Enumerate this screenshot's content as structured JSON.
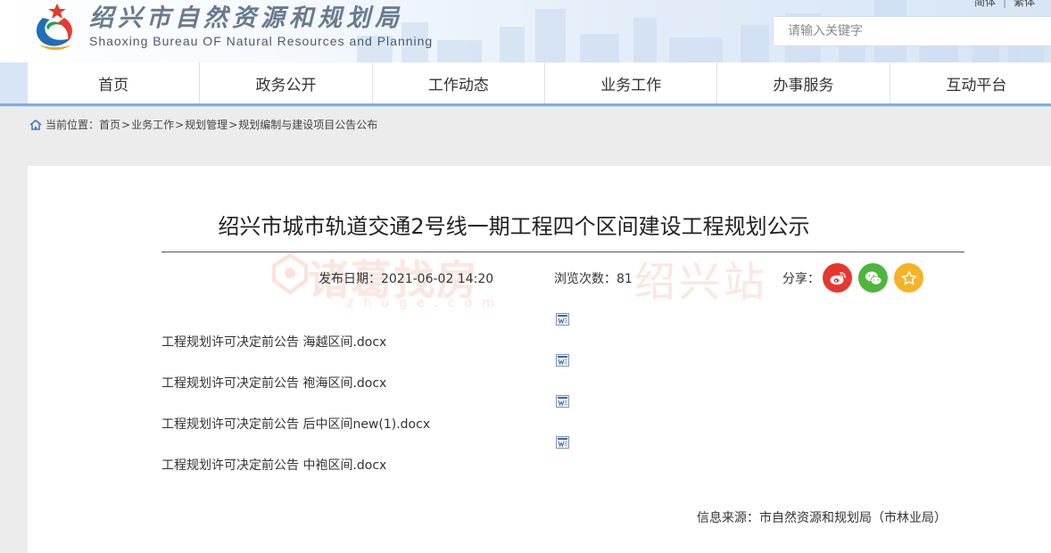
{
  "header": {
    "title": "绍兴市自然资源和规划局",
    "subtitle": "Shaoxing Bureau OF Natural Resources and Planning",
    "lang_simplified": "简体",
    "lang_separator": "|",
    "lang_traditional": "繁体",
    "search_placeholder": "请输入关键字"
  },
  "nav": {
    "items": [
      "首页",
      "政务公开",
      "工作动态",
      "业务工作",
      "办事服务",
      "互动平台"
    ]
  },
  "breadcrumb": {
    "label": "当前位置：",
    "items": [
      "首页",
      "业务工作",
      "规划管理",
      "规划编制与建设项目公告公布"
    ],
    "separator": ">"
  },
  "article": {
    "title": "绍兴市城市轨道交通2号线一期工程四个区间建设工程规划公示",
    "date_label": "发布日期：",
    "date": "2021-06-02 14:20",
    "views_label": "浏览次数：",
    "views": "81",
    "share_label": "分享：",
    "attachments": [
      "工程规划许可决定前公告 海越区间.docx",
      "工程规划许可决定前公告 袍海区间.docx",
      "工程规划许可决定前公告 后中区间new(1).docx",
      "工程规划许可决定前公告 中袍区间.docx"
    ],
    "source_label": "信息来源：",
    "source": "市自然资源和规划局（市林业局）"
  },
  "watermark": {
    "brand": "诸葛找房",
    "city": "绍兴站",
    "domain": "zhuge.com"
  },
  "icons": {
    "share_weibo": "weibo-icon",
    "share_wechat": "wechat-icon",
    "share_favorite": "star-icon",
    "attachment": "word-document-icon",
    "home": "home-icon"
  },
  "colors": {
    "nav_underline": "#7eaee5",
    "weibo": "#e6372f",
    "wechat": "#4fb63d",
    "favorite": "#f5b325",
    "watermark": "#f08c6e"
  }
}
